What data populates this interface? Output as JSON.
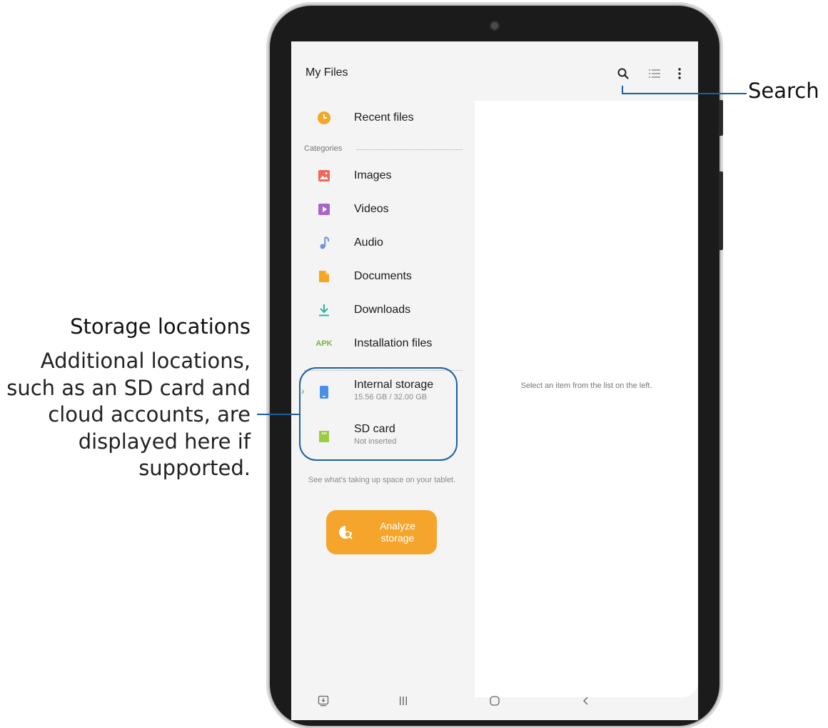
{
  "app": {
    "title": "My Files",
    "toolbar": {
      "search_icon": "search-icon",
      "list_view_icon": "list-view-icon",
      "more_icon": "more-options-icon"
    }
  },
  "sidebar": {
    "recent": {
      "label": "Recent files",
      "icon": "clock-icon",
      "color": "#f5a623"
    },
    "categories_label": "Categories",
    "categories": [
      {
        "label": "Images",
        "icon": "image-icon",
        "color": "#f0665a"
      },
      {
        "label": "Videos",
        "icon": "video-icon",
        "color": "#a865c9"
      },
      {
        "label": "Audio",
        "icon": "music-note-icon",
        "color": "#6f8fe0"
      },
      {
        "label": "Documents",
        "icon": "document-icon",
        "color": "#f5a623"
      },
      {
        "label": "Downloads",
        "icon": "download-icon",
        "color": "#33b0a0"
      },
      {
        "label": "Installation files",
        "icon": "apk-icon",
        "icon_text": "APK",
        "color": "#7cb342"
      }
    ],
    "storage": [
      {
        "label": "Internal storage",
        "detail": "15.56 GB / 32.00 GB",
        "icon": "phone-storage-icon",
        "color": "#4a8fe8"
      },
      {
        "label": "SD card",
        "detail": "Not inserted",
        "icon": "sd-card-icon",
        "color": "#9ccc40"
      }
    ],
    "storage_hint": "See what's taking up space on your tablet.",
    "analyze_button": "Analyze storage"
  },
  "detail_pane": {
    "placeholder": "Select an item from the list on the left."
  },
  "nav_bar": [
    "screen-assist-icon",
    "recents-icon",
    "home-icon",
    "back-icon"
  ],
  "annotations": {
    "search": "Search",
    "storage_title": "Storage locations",
    "storage_body": "Additional locations, such as an SD card and cloud accounts, are displayed here if supported.",
    "accent": "#1a5fa0"
  }
}
